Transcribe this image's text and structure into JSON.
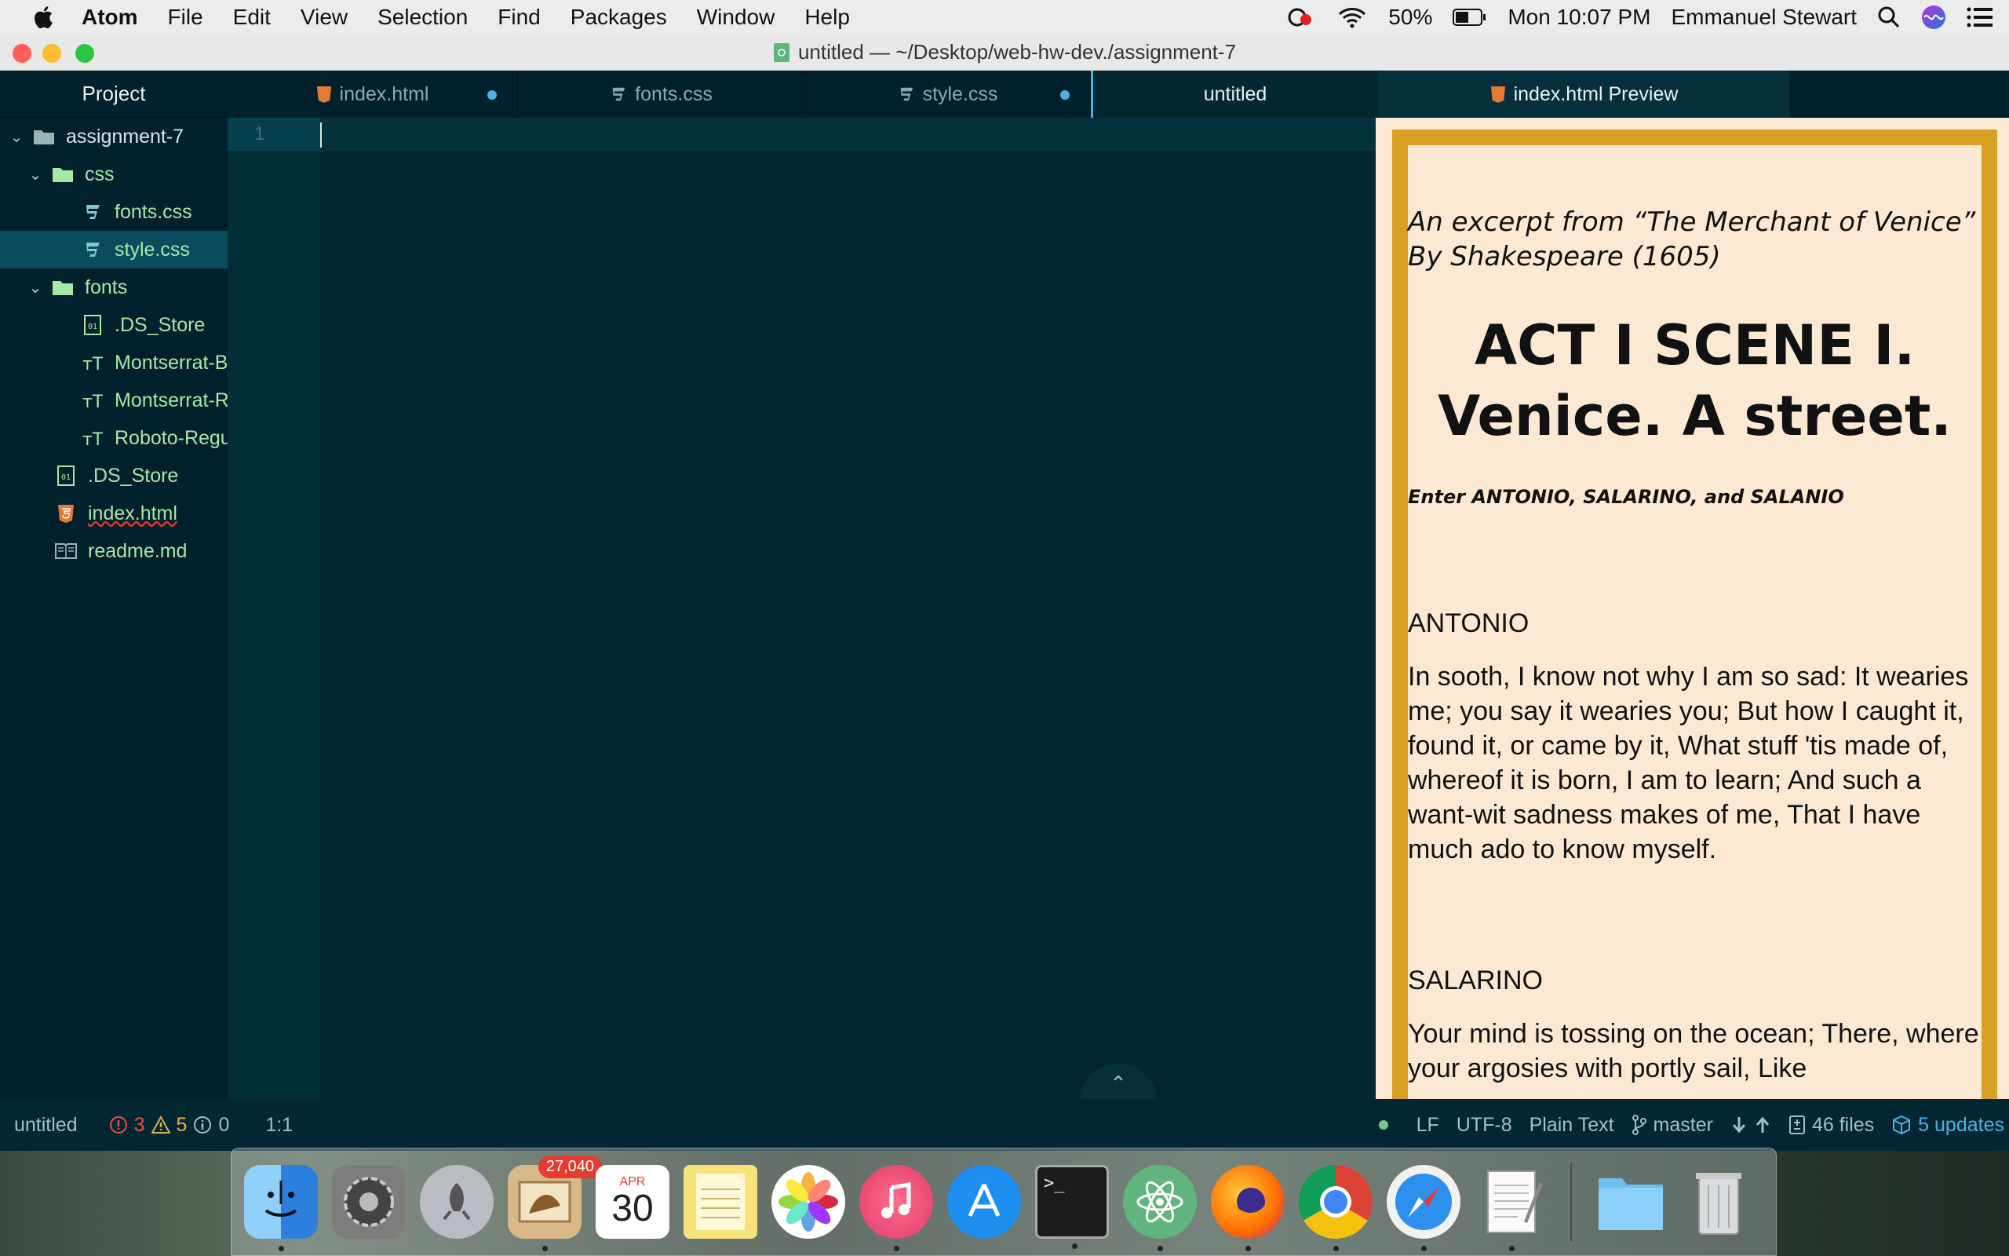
{
  "menubar": {
    "app": "Atom",
    "items": [
      "File",
      "Edit",
      "View",
      "Selection",
      "Find",
      "Packages",
      "Window",
      "Help"
    ],
    "battery": "50%",
    "clock": "Mon 10:07 PM",
    "user": "Emmanuel Stewart"
  },
  "window": {
    "title": "untitled — ~/Desktop/web-hw-dev./assignment-7"
  },
  "tree": {
    "header": "Project",
    "root": "assignment-7",
    "items": [
      {
        "label": "css"
      },
      {
        "label": "fonts.css"
      },
      {
        "label": "style.css"
      },
      {
        "label": "fonts"
      },
      {
        "label": ".DS_Store"
      },
      {
        "label": "Montserrat-B"
      },
      {
        "label": "Montserrat-R"
      },
      {
        "label": "Roboto-Regu"
      },
      {
        "label": ".DS_Store"
      },
      {
        "label": "index.html"
      },
      {
        "label": "readme.md"
      }
    ]
  },
  "tabs": [
    {
      "label": "index.html"
    },
    {
      "label": "fonts.css"
    },
    {
      "label": "style.css"
    },
    {
      "label": "untitled"
    },
    {
      "label": "index.html Preview"
    }
  ],
  "editor": {
    "line_number": "1"
  },
  "preview": {
    "subtitle_line1": "An excerpt from “The Merchant of Venice”",
    "subtitle_line2": "By Shakespeare (1605)",
    "heading_line1": "ACT I SCENE I.",
    "heading_line2": "Venice. A street.",
    "stage_direction": "Enter ANTONIO, SALARINO, and SALANIO",
    "speaker1": "ANTONIO",
    "speech1": "In sooth, I know not why I am so sad: It wearies me; you say it wearies you; But how I caught it, found it, or came by it, What stuff 'tis made of, whereof it is born, I am to learn; And such a want-wit sadness makes of me, That I have much ado to know myself.",
    "speaker2": "SALARINO",
    "speech2": "Your mind is tossing on the ocean; There, where your argosies with portly sail, Like"
  },
  "status": {
    "file": "untitled",
    "errors": "3",
    "warnings": "5",
    "infos": "0",
    "cursor": "1:1",
    "line_ending": "LF",
    "encoding": "UTF-8",
    "grammar": "Plain Text",
    "branch": "master",
    "files": "46 files",
    "updates": "5 updates"
  },
  "dock": {
    "mail_badge": "27,040",
    "calendar_month": "APR",
    "calendar_day": "30"
  },
  "colors": {
    "accent": "#4bb5e6",
    "border": "#d9a124",
    "tree_file": "#a4e9a9"
  }
}
